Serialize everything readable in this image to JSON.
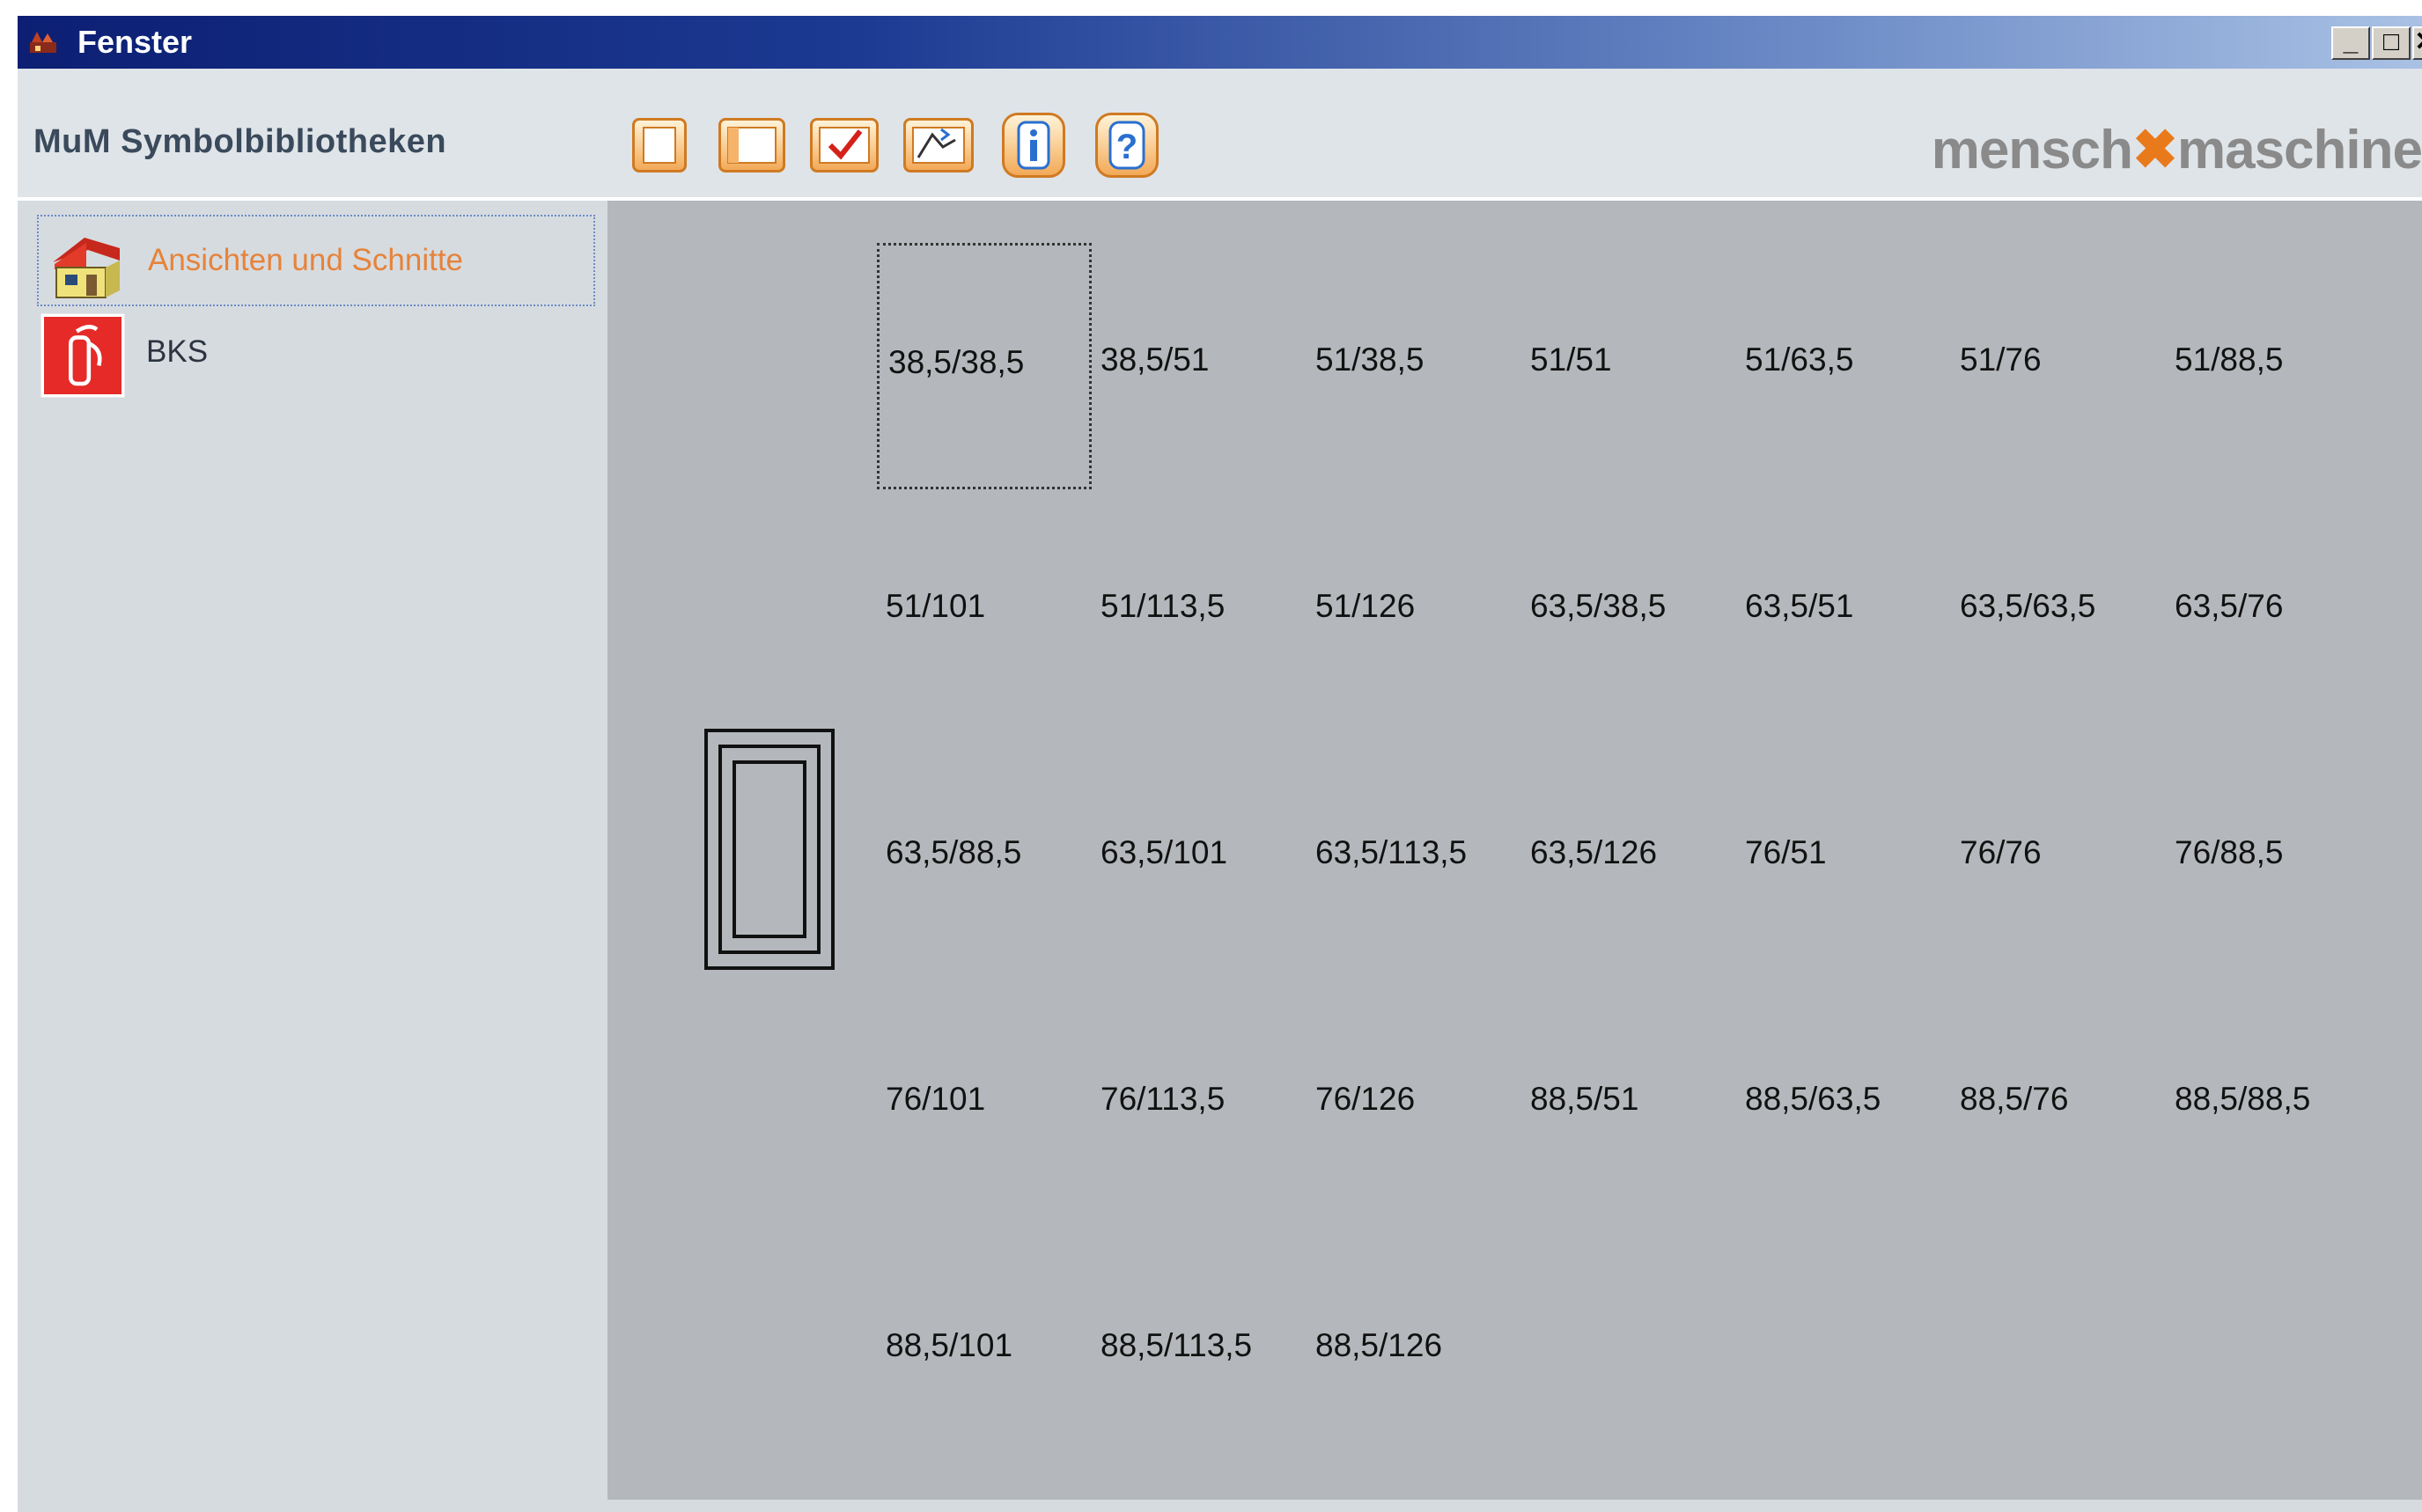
{
  "window": {
    "title": "Fenster"
  },
  "header": {
    "app_label": "MuM Symbolbibliotheken",
    "toolbar": [
      {
        "name": "blank-page-icon"
      },
      {
        "name": "split-page-icon"
      },
      {
        "name": "checkmark-icon"
      },
      {
        "name": "edit-shape-icon"
      },
      {
        "name": "info-icon"
      },
      {
        "name": "help-icon"
      }
    ],
    "logo": {
      "left": "mensch",
      "mark": "✖",
      "right": "maschine"
    },
    "window_buttons": {
      "minimize": "_",
      "maximize": "□",
      "close": "✕"
    }
  },
  "sidebar": {
    "items": [
      {
        "label": "Ansichten und Schnitte",
        "icon": "house-icon",
        "selected": true,
        "color": "#e6833a"
      },
      {
        "label": "BKS",
        "icon": "fire-extinguisher-icon",
        "selected": false,
        "color": "#2b3440"
      }
    ]
  },
  "symbols": {
    "rows": [
      [
        "38,5/38,5",
        "38,5/51",
        "51/38,5",
        "51/51",
        "51/63,5",
        "51/76",
        "51/88,5"
      ],
      [
        "51/101",
        "51/113,5",
        "51/126",
        "63,5/38,5",
        "63,5/51",
        "63,5/63,5",
        "63,5/76"
      ],
      [
        "63,5/88,5",
        "63,5/101",
        "63,5/113,5",
        "63,5/126",
        "76/51",
        "76/76",
        "76/88,5"
      ],
      [
        "76/101",
        "76/113,5",
        "76/126",
        "88,5/51",
        "88,5/63,5",
        "88,5/76",
        "88,5/88,5"
      ],
      [
        "88,5/101",
        "88,5/113,5",
        "88,5/126"
      ]
    ],
    "focused": "38,5/38,5"
  },
  "colors": {
    "accent_orange": "#e97a1b",
    "titlebar_dark": "#0c1f73",
    "content_bg": "#b4b8bc"
  }
}
